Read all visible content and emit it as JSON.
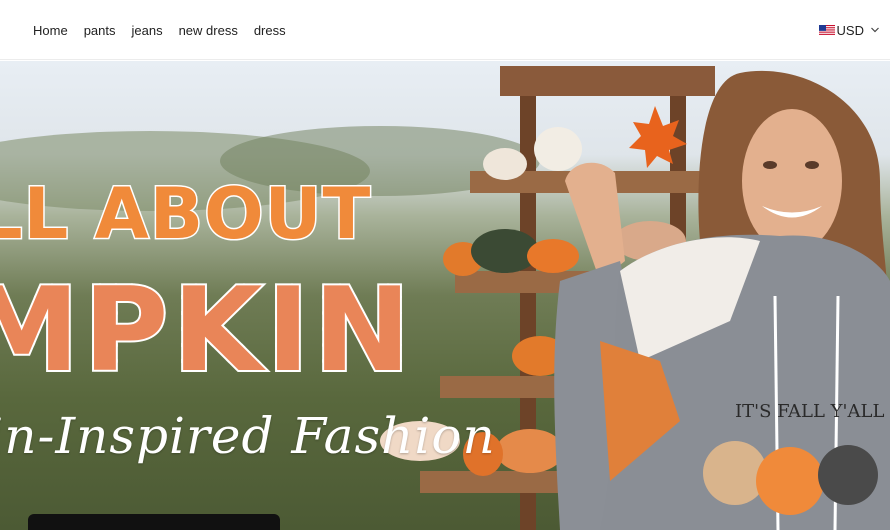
{
  "nav": {
    "items": [
      {
        "label": "Home"
      },
      {
        "label": "pants"
      },
      {
        "label": "jeans"
      },
      {
        "label": "new dress"
      },
      {
        "label": "dress"
      }
    ]
  },
  "currency": {
    "code": "USD",
    "flag_icon": "us-flag-icon",
    "chevron_icon": "chevron-down-icon"
  },
  "hero": {
    "line1": "LL ABOUT",
    "line2": "MPKIN",
    "line3": "kin-Inspired Fashion",
    "shirt_text": "IT'S FALL Y'ALL",
    "colors": {
      "orange": "#f08a3a",
      "pumpkin_dots": "#e98558",
      "cta": "#111111"
    }
  }
}
